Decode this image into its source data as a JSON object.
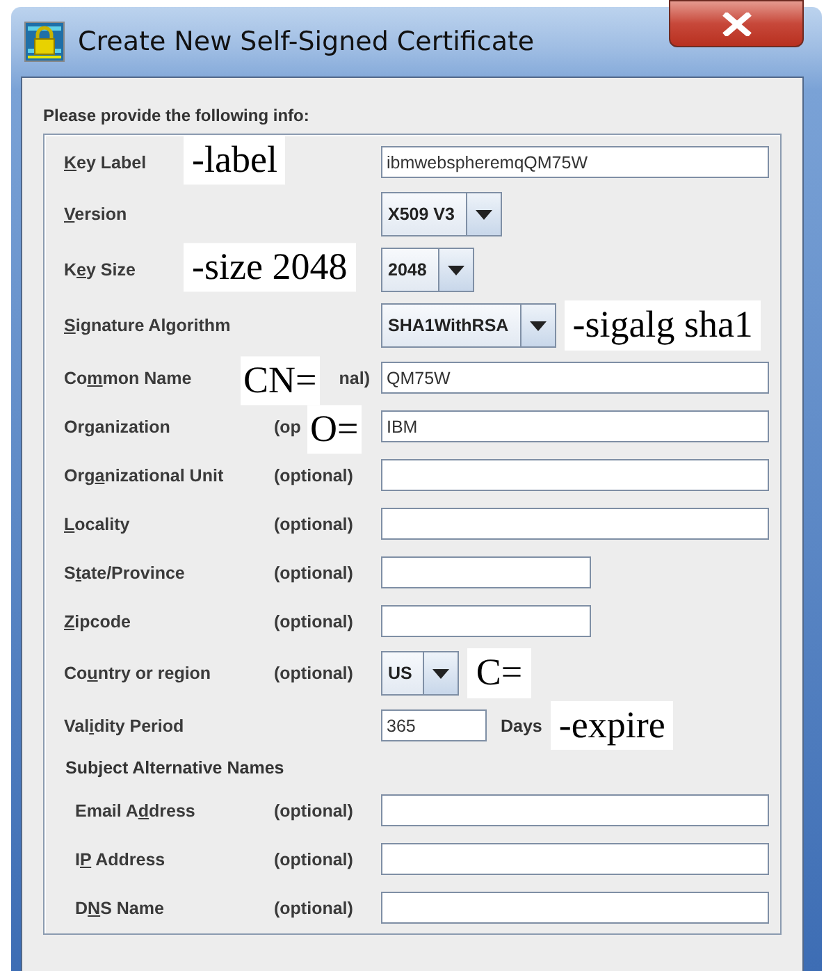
{
  "window": {
    "title": "Create New Self-Signed Certificate"
  },
  "form": {
    "heading": "Please provide the following info:",
    "rows": [
      {
        "kind": "field",
        "label": {
          "key": "K",
          "after": "ey Label"
        },
        "value": "ibmwebspheremqQM75W",
        "annotation": {
          "text": "-label",
          "kind": "middle"
        }
      },
      {
        "kind": "combo",
        "label": {
          "key": "V",
          "after": "ersion"
        },
        "value": "X509 V3"
      },
      {
        "kind": "combo",
        "label": {
          "before": "K",
          "key": "e",
          "after": "y Size"
        },
        "value": "2048",
        "annotation": {
          "text": "-size 2048",
          "kind": "middle"
        }
      },
      {
        "kind": "combo",
        "label": {
          "key": "S",
          "after": "ignature Algorithm"
        },
        "value": "SHA1WithRSA",
        "annotation": {
          "text": "-sigalg  sha1",
          "kind": "after"
        }
      },
      {
        "kind": "field",
        "label": {
          "before": "Co",
          "key": "m",
          "after": "mon Name"
        },
        "optional": "nal)",
        "value": "QM75W",
        "annotation": {
          "text": "CN=",
          "kind": "leading"
        }
      },
      {
        "kind": "field",
        "label": {
          "before": "Or",
          "key": "g",
          "after": "anization"
        },
        "optional": "(op",
        "value": "IBM",
        "annotation": {
          "text": "O=",
          "kind": "trailing"
        }
      },
      {
        "kind": "field",
        "label": {
          "before": "Org",
          "key": "a",
          "after": "nizational Unit"
        },
        "optional": "(optional)"
      },
      {
        "kind": "field",
        "label": {
          "key": "L",
          "after": "ocality"
        },
        "optional": "(optional)"
      },
      {
        "kind": "short-field",
        "label": {
          "before": "S",
          "key": "t",
          "after": "ate/Province"
        },
        "optional": "(optional)"
      },
      {
        "kind": "short-field",
        "label": {
          "key": "Z",
          "after": "ipcode"
        },
        "optional": "(optional)"
      },
      {
        "kind": "combo",
        "label": {
          "before": "Co",
          "key": "u",
          "after": "ntry or region"
        },
        "optional": "(optional)",
        "value": "US",
        "annotation": {
          "text": "C=",
          "kind": "after"
        }
      },
      {
        "kind": "period",
        "label": {
          "before": "Val",
          "key": "i",
          "after": "dity Period"
        },
        "value": "365",
        "unit": "Days",
        "annotation": {
          "text": "-expire",
          "kind": "after"
        }
      },
      {
        "kind": "section",
        "title": "Subject Alternative Names",
        "rows": [
          {
            "kind": "field",
            "label": {
              "before": "Email A",
              "key": "d",
              "after": "dress"
            },
            "optional": "(optional)"
          },
          {
            "kind": "field",
            "label": {
              "before": "I",
              "key": "P",
              "after": " Address"
            },
            "optional": "(optional)"
          },
          {
            "kind": "field",
            "label": {
              "before": "D",
              "key": "N",
              "after": "S Name"
            },
            "optional": "(optional)"
          }
        ]
      }
    ]
  }
}
